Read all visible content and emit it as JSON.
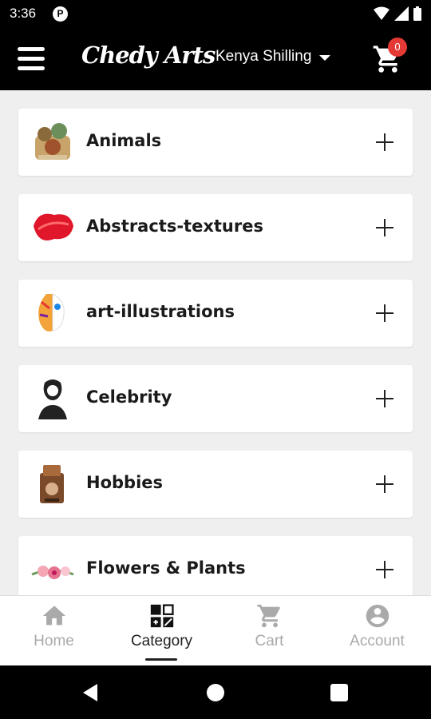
{
  "status_bar": {
    "time": "3:36",
    "notif_glyph": "P"
  },
  "app_bar": {
    "logo_text": "Chedy Arts",
    "currency_label": "Kenya Shilling",
    "cart_count": "0"
  },
  "categories": [
    {
      "label": "Animals",
      "icon": "animals-thumbnail"
    },
    {
      "label": "Abstracts-textures",
      "icon": "abstract-thumbnail"
    },
    {
      "label": "art-illustrations",
      "icon": "illustration-thumbnail"
    },
    {
      "label": "Celebrity",
      "icon": "celebrity-thumbnail"
    },
    {
      "label": "Hobbies",
      "icon": "hobbies-thumbnail"
    },
    {
      "label": "Flowers & Plants",
      "icon": "flowers-thumbnail"
    }
  ],
  "bottom_nav": [
    {
      "label": "Home",
      "icon": "home-icon",
      "active": false
    },
    {
      "label": "Category",
      "icon": "category-icon",
      "active": true
    },
    {
      "label": "Cart",
      "icon": "cart-icon",
      "active": false
    },
    {
      "label": "Account",
      "icon": "account-icon",
      "active": false
    }
  ],
  "colors": {
    "bar_bg": "#000000",
    "badge": "#e53935",
    "page_bg": "#efefef",
    "inactive_nav": "#aaaaaa"
  }
}
